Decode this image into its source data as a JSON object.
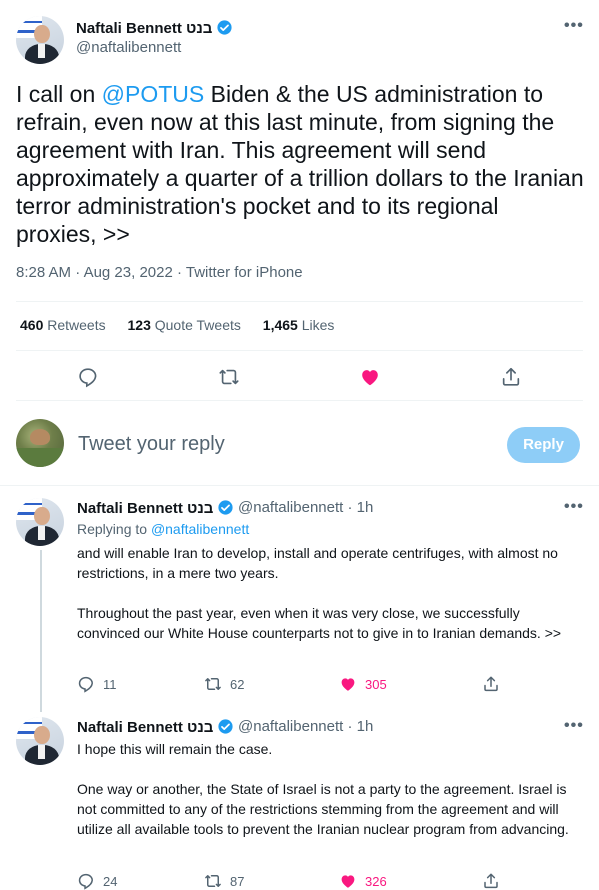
{
  "main_tweet": {
    "author_name": "Naftali Bennett בנט",
    "handle": "@naftalibennett",
    "text_mention": "@POTUS",
    "text_before": "I call on ",
    "text_after": " Biden & the US administration to refrain, even now at this last minute, from signing the agreement with Iran. This agreement will send approximately a quarter of a trillion dollars to the Iranian terror administration's pocket and to its regional proxies, >>",
    "time": "8:28 AM",
    "date": "Aug 23, 2022",
    "source": "Twitter for iPhone",
    "retweets_count": "460",
    "retweets_label": "Retweets",
    "quotes_count": "123",
    "quotes_label": "Quote Tweets",
    "likes_count": "1,465",
    "likes_label": "Likes"
  },
  "reply_box": {
    "placeholder": "Tweet your reply",
    "button_label": "Reply"
  },
  "thread": [
    {
      "author_name": "Naftali Bennett בנט",
      "handle": "@naftalibennett",
      "time_ago": "1h",
      "replying_label": "Replying to",
      "replying_handle": "@naftalibennett",
      "paragraphs": [
        "and will enable Iran to develop, install and operate centrifuges, with almost no restrictions, in a mere two years.",
        "Throughout the past year, even when it was very close, we successfully convinced our White House counterparts not to give in to Iranian demands. >>"
      ],
      "replies": "11",
      "retweets": "62",
      "likes": "305"
    },
    {
      "author_name": "Naftali Bennett בנט",
      "handle": "@naftalibennett",
      "time_ago": "1h",
      "paragraphs": [
        "I hope this will remain the case.",
        "One way or another, the State of Israel is not a party to the agreement. Israel is not committed to any of the restrictions stemming from the agreement and will utilize all available tools to prevent the Iranian nuclear program from advancing."
      ],
      "replies": "24",
      "retweets": "87",
      "likes": "326"
    }
  ],
  "colors": {
    "accent": "#1d9bf0",
    "like": "#f91880",
    "muted": "#536471",
    "reply_button": "#8ecdf7"
  },
  "icons": [
    "more-icon",
    "verified-icon",
    "reply-icon",
    "retweet-icon",
    "like-icon",
    "share-icon"
  ]
}
